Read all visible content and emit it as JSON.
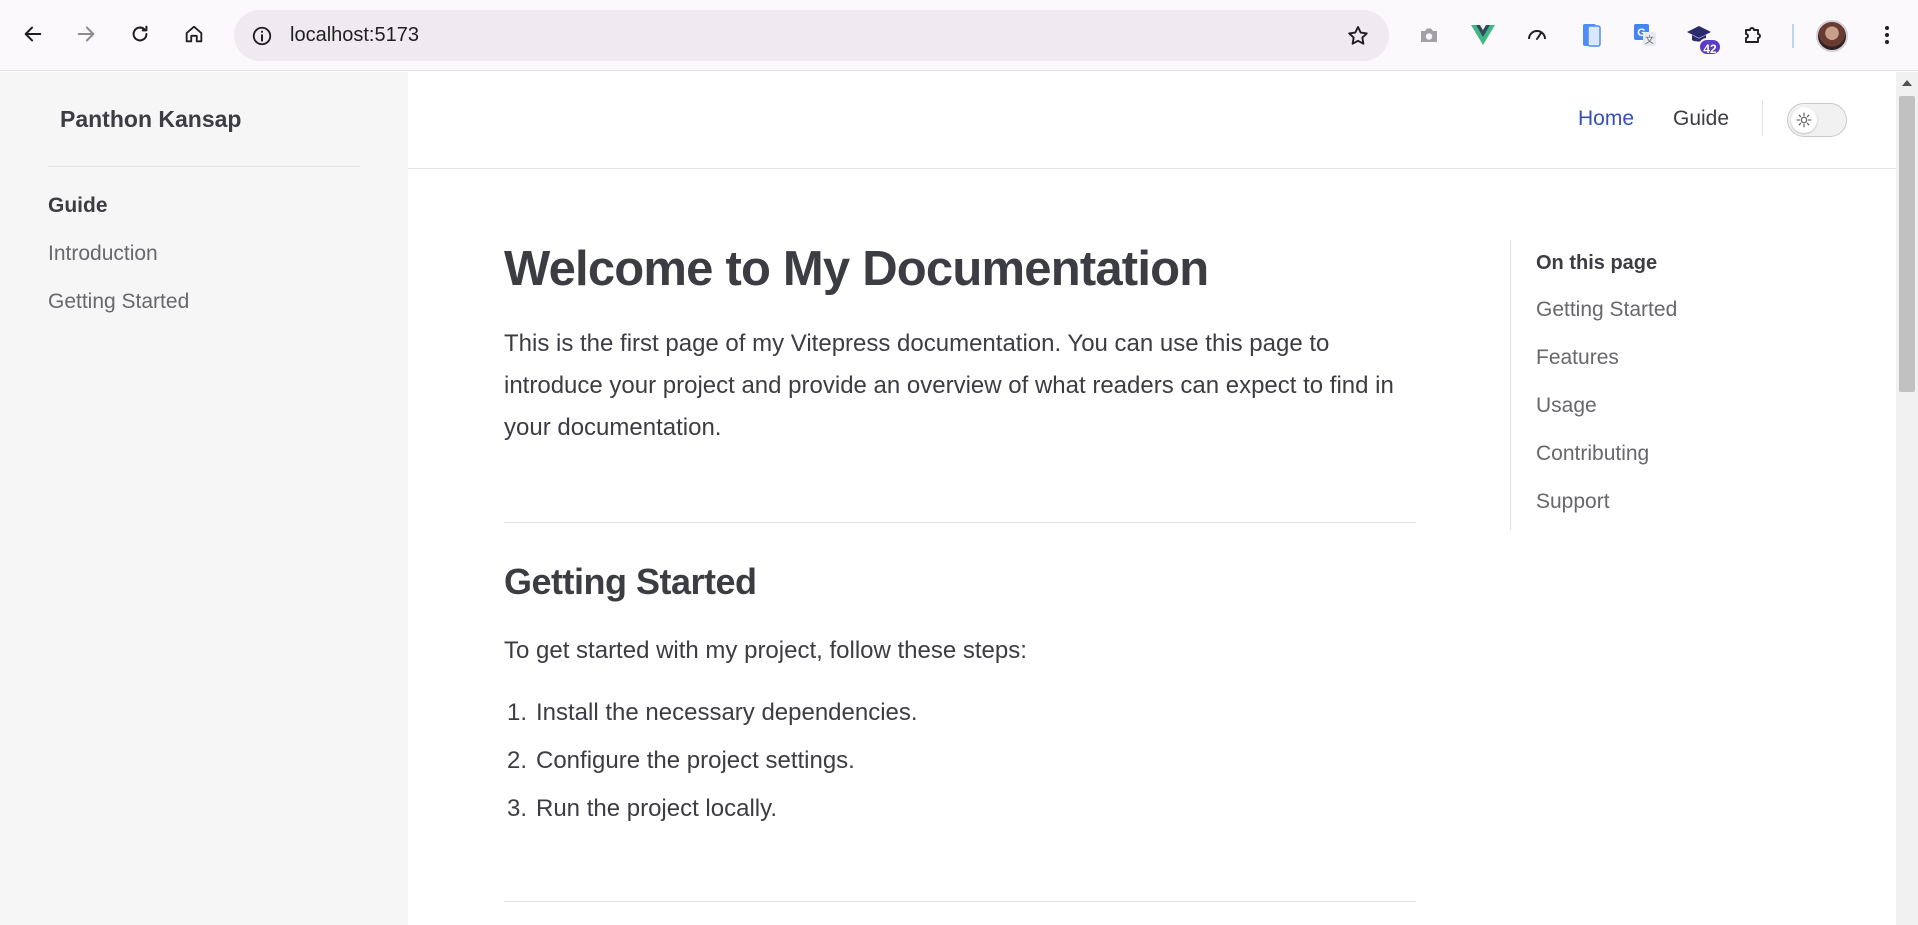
{
  "browser": {
    "url": "localhost:5173",
    "extension_badge": "42",
    "icons": [
      "back-icon",
      "forward-icon",
      "reload-icon",
      "home-icon",
      "site-info-icon",
      "bookmark-star-icon",
      "camera-icon",
      "vue-devtools-icon",
      "speed-icon",
      "phone-icon",
      "translate-icon",
      "mortarboard-icon",
      "extensions-icon",
      "profile-avatar",
      "more-icon"
    ]
  },
  "sidebar": {
    "site_title": "Panthon Kansap",
    "group_title": "Guide",
    "items": [
      {
        "label": "Introduction"
      },
      {
        "label": "Getting Started"
      }
    ]
  },
  "topnav": {
    "links": [
      {
        "label": "Home",
        "active": true
      },
      {
        "label": "Guide",
        "active": false
      }
    ],
    "theme_icon": "sun-icon"
  },
  "main": {
    "title": "Welcome to My Documentation",
    "intro": "This is the first page of my Vitepress documentation. You can use this page to introduce your project and provide an overview of what readers can expect to find in your documentation.",
    "section_title": "Getting Started",
    "section_intro": "To get started with my project, follow these steps:",
    "steps": [
      {
        "num": "1.",
        "text": "Install the necessary dependencies."
      },
      {
        "num": "2.",
        "text": "Configure the project settings."
      },
      {
        "num": "3.",
        "text": "Run the project locally."
      }
    ]
  },
  "outline": {
    "title": "On this page",
    "items": [
      {
        "label": "Getting Started"
      },
      {
        "label": "Features"
      },
      {
        "label": "Usage"
      },
      {
        "label": "Contributing"
      },
      {
        "label": "Support"
      }
    ]
  },
  "colors": {
    "accent": "#3451b2",
    "text": "#3c3c43",
    "muted": "#67676c",
    "sidebar_bg": "#f6f6f7"
  }
}
